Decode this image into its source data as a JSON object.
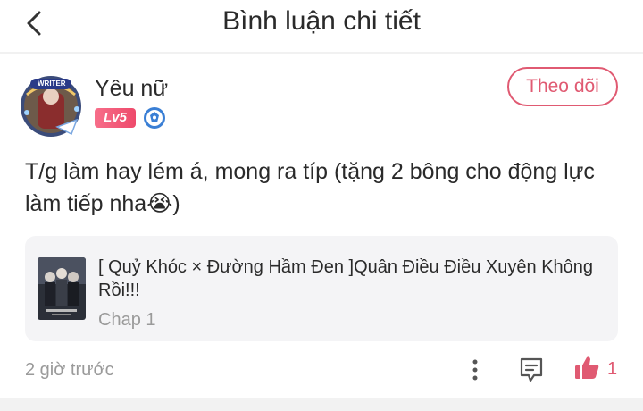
{
  "header": {
    "title": "Bình luận chi tiết"
  },
  "comment": {
    "user": {
      "name": "Yêu nữ",
      "level_badge": "Lv5",
      "avatar_frame_text": "WRITER"
    },
    "follow_label": "Theo dõi",
    "text": "T/g làm hay lém á, mong ra típ (tặng 2 bông cho động lực làm tiếp nha😭)",
    "story": {
      "title": "[ Quỷ Khóc × Đường Hầm Đen ]Quân Điều Điều Xuyên Không Rồi!!!",
      "chapter": "Chap 1"
    },
    "timestamp": "2 giờ trước",
    "like_count": "1"
  },
  "colors": {
    "accent": "#e05a72",
    "badge": "#ee4a6b",
    "card_bg": "#f4f4f6",
    "muted_text": "#9a9a9a"
  },
  "icons": [
    "back-icon",
    "shield-icon",
    "more-vertical-icon",
    "comment-icon",
    "thumbs-up-icon"
  ]
}
